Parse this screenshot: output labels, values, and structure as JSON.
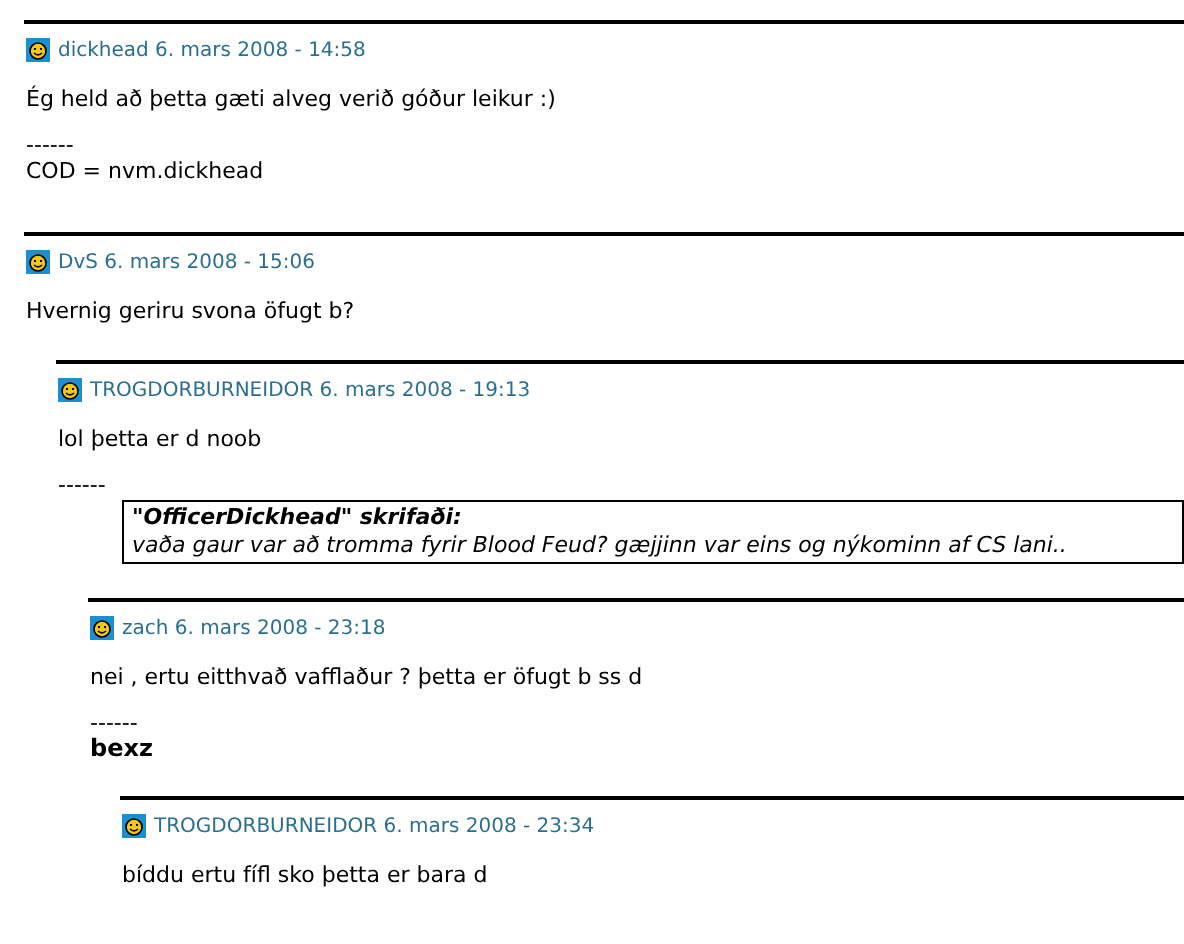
{
  "comments": [
    {
      "author": "dickhead",
      "date": "6. mars 2008 - 14:58",
      "body": [
        {
          "kind": "text",
          "text": "Ég held að þetta gæti alveg verið góður leikur :)"
        },
        {
          "kind": "signature",
          "lines": [
            {
              "text": "------",
              "bold": false
            },
            {
              "text": "COD = nvm.dickhead",
              "bold": false
            }
          ]
        }
      ]
    },
    {
      "author": "DvS",
      "date": "6. mars 2008 - 15:06",
      "body": [
        {
          "kind": "text",
          "text": "Hvernig geriru svona öfugt b?"
        }
      ],
      "children": [
        {
          "author": "TROGDORBURNEIDOR",
          "date": "6. mars 2008 - 19:13",
          "body": [
            {
              "kind": "text",
              "text": "lol þetta er d noob"
            },
            {
              "kind": "signature",
              "lines": [
                {
                  "text": "------",
                  "bold": false
                }
              ]
            },
            {
              "kind": "quote",
              "heading": "\"OfficerDickhead\" skrifaði:",
              "text": "vaða gaur var að tromma fyrir Blood Feud? gæjjinn var eins og nýkominn af CS lani.."
            }
          ],
          "children": [
            {
              "author": "zach",
              "date": "6. mars 2008 - 23:18",
              "body": [
                {
                  "kind": "text",
                  "text": "nei , ertu eitthvað vafflaður ? þetta er öfugt b ss d"
                },
                {
                  "kind": "signature",
                  "lines": [
                    {
                      "text": "------",
                      "bold": false
                    },
                    {
                      "text": "bexz",
                      "bold": true
                    }
                  ]
                }
              ],
              "children": [
                {
                  "author": "TROGDORBURNEIDOR",
                  "date": "6. mars 2008 - 23:34",
                  "body": [
                    {
                      "kind": "text",
                      "text": "bíddu ertu fífl sko þetta er bara d"
                    }
                  ]
                }
              ]
            }
          ]
        }
      ]
    }
  ]
}
